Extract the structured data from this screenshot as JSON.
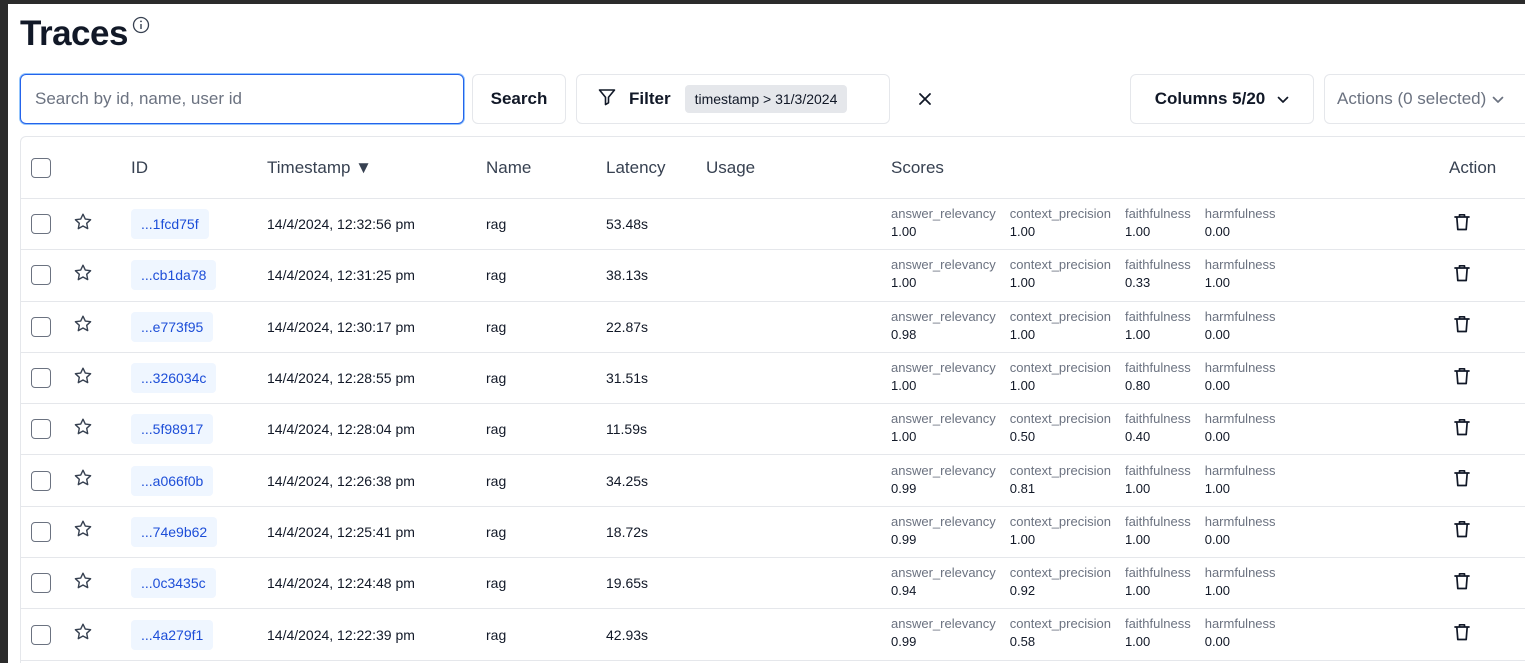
{
  "page": {
    "title": "Traces"
  },
  "toolbar": {
    "search_placeholder": "Search by id, name, user id",
    "search_label": "Search",
    "filter_label": "Filter",
    "filter_chip": "timestamp > 31/3/2024",
    "columns_label": "Columns 5/20",
    "actions_label": "Actions (0 selected)"
  },
  "table": {
    "columns": {
      "id": "ID",
      "timestamp": "Timestamp ▼",
      "name": "Name",
      "latency": "Latency",
      "usage": "Usage",
      "scores": "Scores",
      "action": "Action"
    },
    "rows": [
      {
        "id": "...1fcd75f",
        "timestamp": "14/4/2024, 12:32:56 pm",
        "name": "rag",
        "latency": "53.48s",
        "scores": [
          {
            "name": "answer_relevancy",
            "value": "1.00"
          },
          {
            "name": "context_precision",
            "value": "1.00"
          },
          {
            "name": "faithfulness",
            "value": "1.00"
          },
          {
            "name": "harmfulness",
            "value": "0.00"
          }
        ]
      },
      {
        "id": "...cb1da78",
        "timestamp": "14/4/2024, 12:31:25 pm",
        "name": "rag",
        "latency": "38.13s",
        "scores": [
          {
            "name": "answer_relevancy",
            "value": "1.00"
          },
          {
            "name": "context_precision",
            "value": "1.00"
          },
          {
            "name": "faithfulness",
            "value": "0.33"
          },
          {
            "name": "harmfulness",
            "value": "1.00"
          }
        ]
      },
      {
        "id": "...e773f95",
        "timestamp": "14/4/2024, 12:30:17 pm",
        "name": "rag",
        "latency": "22.87s",
        "scores": [
          {
            "name": "answer_relevancy",
            "value": "0.98"
          },
          {
            "name": "context_precision",
            "value": "1.00"
          },
          {
            "name": "faithfulness",
            "value": "1.00"
          },
          {
            "name": "harmfulness",
            "value": "0.00"
          }
        ]
      },
      {
        "id": "...326034c",
        "timestamp": "14/4/2024, 12:28:55 pm",
        "name": "rag",
        "latency": "31.51s",
        "scores": [
          {
            "name": "answer_relevancy",
            "value": "1.00"
          },
          {
            "name": "context_precision",
            "value": "1.00"
          },
          {
            "name": "faithfulness",
            "value": "0.80"
          },
          {
            "name": "harmfulness",
            "value": "0.00"
          }
        ]
      },
      {
        "id": "...5f98917",
        "timestamp": "14/4/2024, 12:28:04 pm",
        "name": "rag",
        "latency": "11.59s",
        "scores": [
          {
            "name": "answer_relevancy",
            "value": "1.00"
          },
          {
            "name": "context_precision",
            "value": "0.50"
          },
          {
            "name": "faithfulness",
            "value": "0.40"
          },
          {
            "name": "harmfulness",
            "value": "0.00"
          }
        ]
      },
      {
        "id": "...a066f0b",
        "timestamp": "14/4/2024, 12:26:38 pm",
        "name": "rag",
        "latency": "34.25s",
        "scores": [
          {
            "name": "answer_relevancy",
            "value": "0.99"
          },
          {
            "name": "context_precision",
            "value": "0.81"
          },
          {
            "name": "faithfulness",
            "value": "1.00"
          },
          {
            "name": "harmfulness",
            "value": "1.00"
          }
        ]
      },
      {
        "id": "...74e9b62",
        "timestamp": "14/4/2024, 12:25:41 pm",
        "name": "rag",
        "latency": "18.72s",
        "scores": [
          {
            "name": "answer_relevancy",
            "value": "0.99"
          },
          {
            "name": "context_precision",
            "value": "1.00"
          },
          {
            "name": "faithfulness",
            "value": "1.00"
          },
          {
            "name": "harmfulness",
            "value": "0.00"
          }
        ]
      },
      {
        "id": "...0c3435c",
        "timestamp": "14/4/2024, 12:24:48 pm",
        "name": "rag",
        "latency": "19.65s",
        "scores": [
          {
            "name": "answer_relevancy",
            "value": "0.94"
          },
          {
            "name": "context_precision",
            "value": "0.92"
          },
          {
            "name": "faithfulness",
            "value": "1.00"
          },
          {
            "name": "harmfulness",
            "value": "1.00"
          }
        ]
      },
      {
        "id": "...4a279f1",
        "timestamp": "14/4/2024, 12:22:39 pm",
        "name": "rag",
        "latency": "42.93s",
        "scores": [
          {
            "name": "answer_relevancy",
            "value": "0.99"
          },
          {
            "name": "context_precision",
            "value": "0.58"
          },
          {
            "name": "faithfulness",
            "value": "1.00"
          },
          {
            "name": "harmfulness",
            "value": "0.00"
          }
        ]
      }
    ]
  },
  "icons": {
    "info": "info-icon",
    "filter": "filter-icon",
    "close": "close-icon",
    "chevron": "chevron-down-icon",
    "star": "star-icon",
    "trash": "trash-icon"
  },
  "colors": {
    "accent": "#2563eb",
    "id_chip_bg": "#eff6ff",
    "id_chip_text": "#1d4ed8"
  }
}
